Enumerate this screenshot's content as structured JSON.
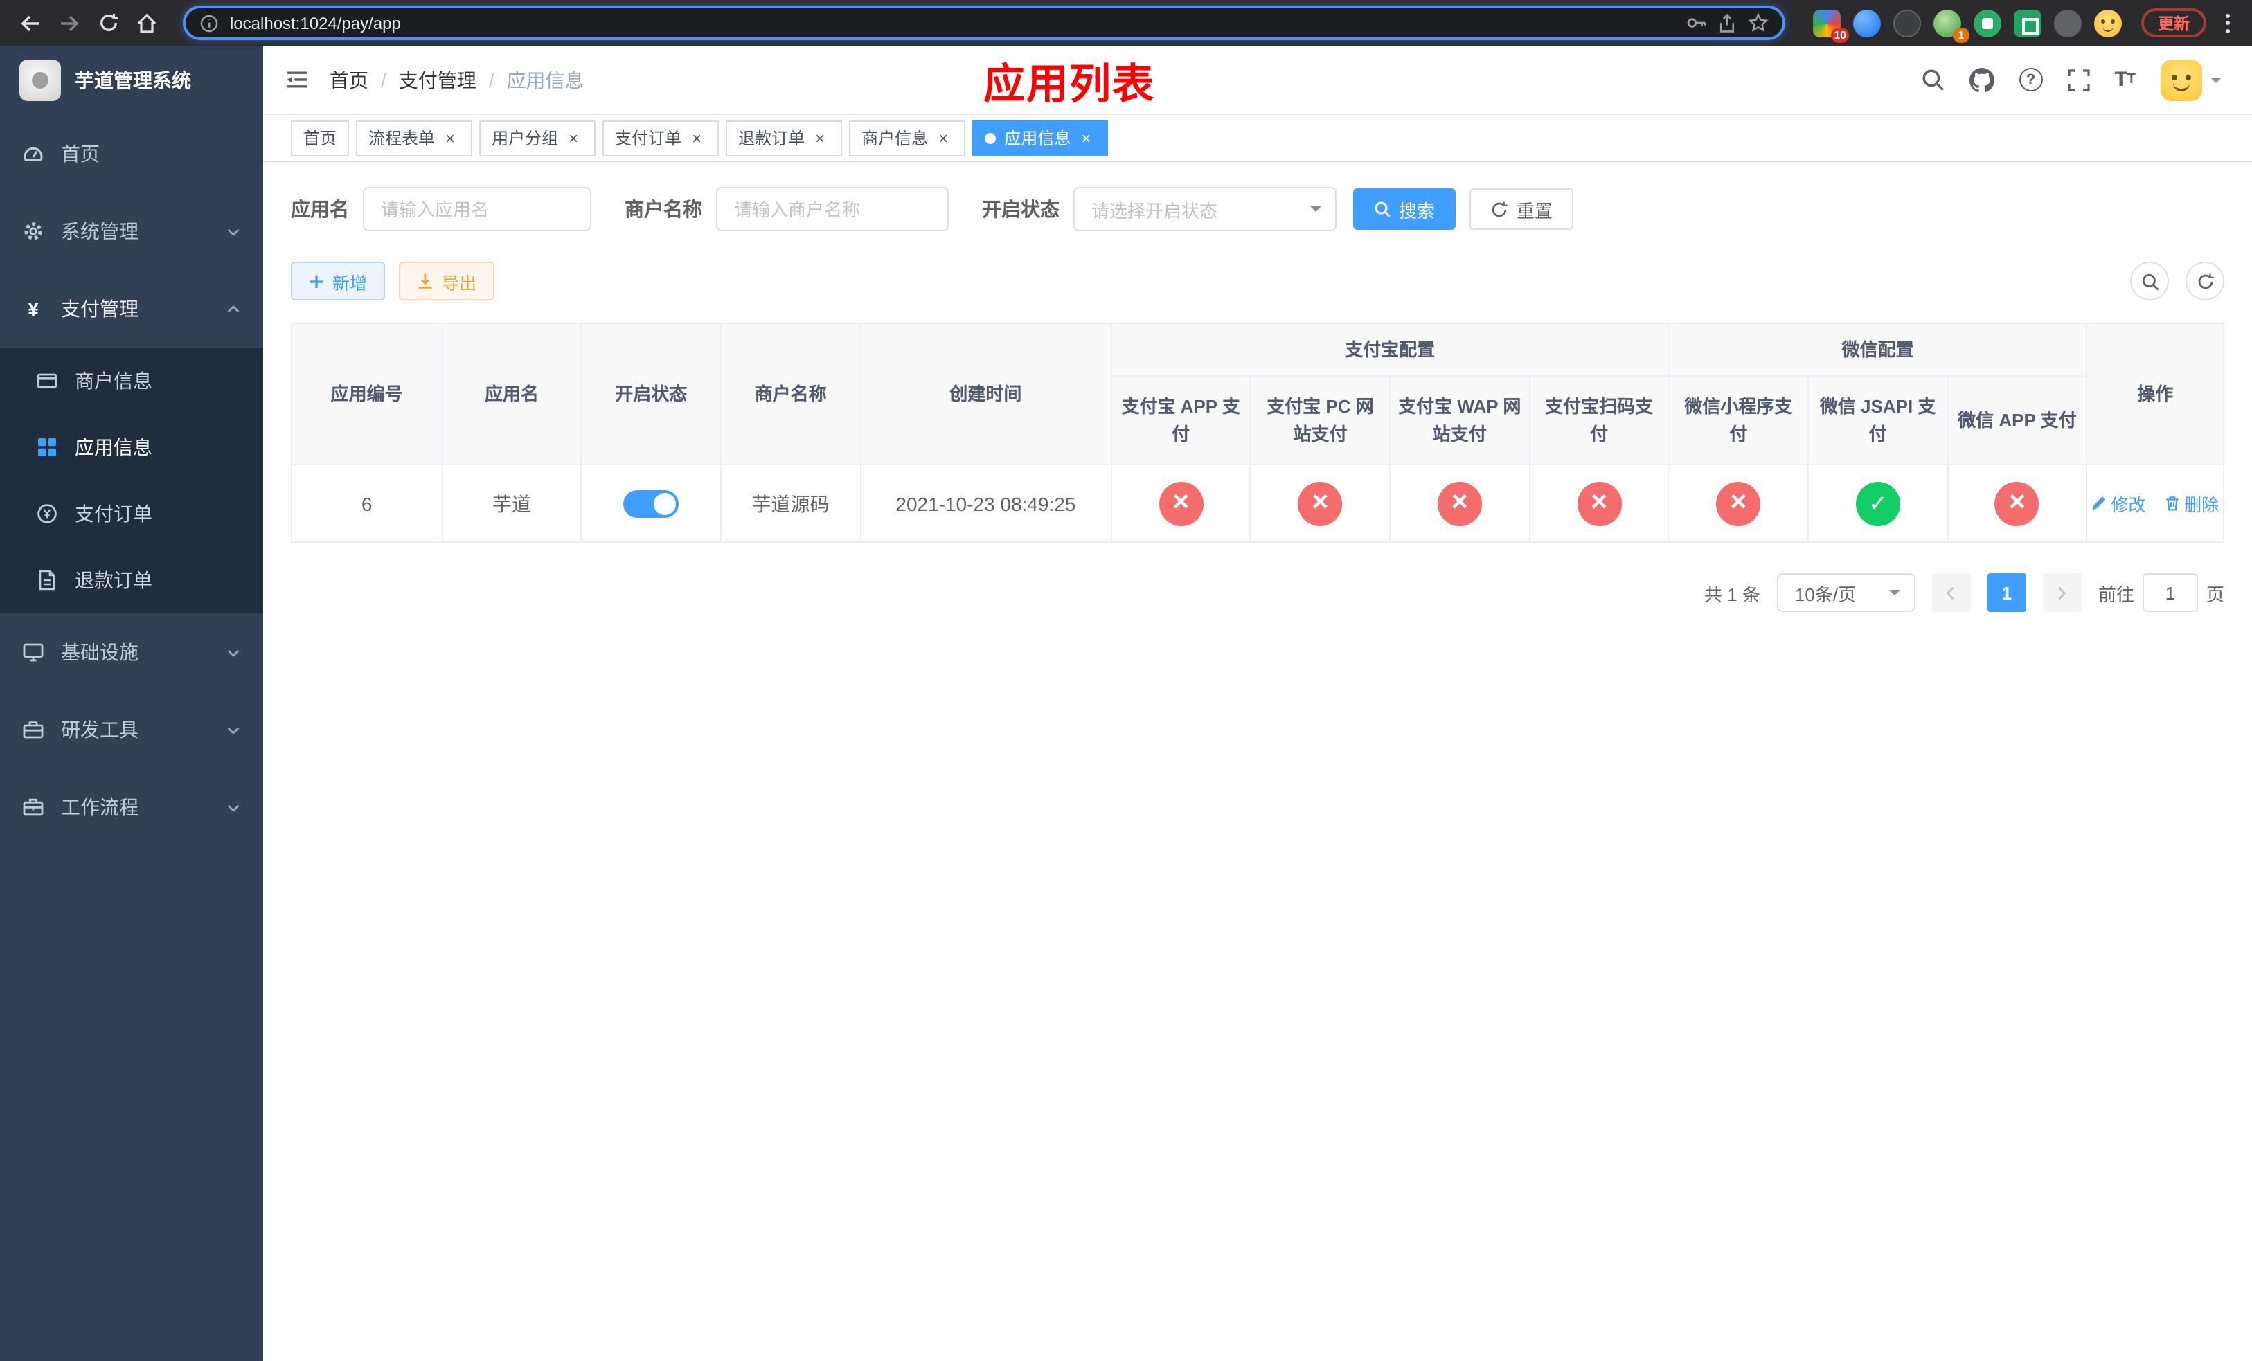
{
  "colors": {
    "accent_blue": "#409eff",
    "success_green": "#13ce66",
    "danger_red": "#f56c6c",
    "warning_orange": "#e6a23c",
    "title_red": "#ff0000",
    "sidebar_bg": "#304156",
    "sidebar_submenu_bg": "#1f2d3d"
  },
  "browser": {
    "url": "localhost:1024/pay/app",
    "update_button": "更新",
    "extensions": [
      {
        "name": "ext-multicolor",
        "badge": "10"
      },
      {
        "name": "ext-blue",
        "badge": ""
      },
      {
        "name": "ext-dark",
        "badge": ""
      },
      {
        "name": "ext-green-avatar",
        "badge": "1"
      },
      {
        "name": "ext-green-circle",
        "badge": ""
      },
      {
        "name": "ext-green-square",
        "badge": ""
      },
      {
        "name": "ext-gray-pin",
        "badge": ""
      },
      {
        "name": "ext-yellow-face",
        "badge": ""
      }
    ]
  },
  "icons": {
    "browser": [
      "back",
      "forward",
      "reload",
      "home",
      "info",
      "key",
      "share",
      "star",
      "menu-dots"
    ],
    "navbar": [
      "hamburger",
      "search",
      "github",
      "help",
      "fullscreen",
      "font-size",
      "avatar",
      "caret-down"
    ]
  },
  "sidebar": {
    "app_title": "芋道管理系统",
    "items": {
      "home": "首页",
      "system": "系统管理",
      "payment": "支付管理",
      "merchant_info": "商户信息",
      "app_info": "应用信息",
      "pay_order": "支付订单",
      "refund_order": "退款订单",
      "infra": "基础设施",
      "dev_tools": "研发工具",
      "workflow": "工作流程"
    }
  },
  "navbar": {
    "breadcrumb": {
      "home": "首页",
      "payment": "支付管理",
      "current": "应用信息"
    },
    "page_title": "应用列表"
  },
  "tabs": [
    {
      "label": "首页"
    },
    {
      "label": "流程表单"
    },
    {
      "label": "用户分组"
    },
    {
      "label": "支付订单"
    },
    {
      "label": "退款订单"
    },
    {
      "label": "商户信息"
    },
    {
      "label": "应用信息"
    }
  ],
  "filters": {
    "app_name": {
      "label": "应用名",
      "placeholder": "请输入应用名",
      "value": ""
    },
    "merchant_name": {
      "label": "商户名称",
      "placeholder": "请输入商户名称",
      "value": ""
    },
    "status": {
      "label": "开启状态",
      "placeholder": "请选择开启状态",
      "value": ""
    },
    "search": "搜索",
    "reset": "重置"
  },
  "actions": {
    "add": "新增",
    "export": "导出"
  },
  "table": {
    "groups": {
      "alipay": "支付宝配置",
      "wechat": "微信配置"
    },
    "headers": {
      "id": "应用编号",
      "name": "应用名",
      "status": "开启状态",
      "merchant": "商户名称",
      "created": "创建时间",
      "alipay_app": "支付宝 APP 支付",
      "alipay_pc": "支付宝 PC 网站支付",
      "alipay_wap": "支付宝 WAP 网站支付",
      "alipay_qr": "支付宝扫码支付",
      "wx_mini": "微信小程序支付",
      "wx_jsapi": "微信 JSAPI 支付",
      "wx_app": "微信 APP 支付",
      "ops": "操作"
    },
    "rows": [
      {
        "id": "6",
        "name": "芋道",
        "enabled": true,
        "merchant": "芋道源码",
        "created": "2021-10-23 08:49:25",
        "alipay_app": false,
        "alipay_pc": false,
        "alipay_wap": false,
        "alipay_qr": false,
        "wx_mini": false,
        "wx_jsapi": true,
        "wx_app": false,
        "edit": "修改",
        "remove": "删除"
      }
    ]
  },
  "pagination": {
    "total": "共 1 条",
    "page_size": "10条/页",
    "page": "1",
    "goto_label": "前往",
    "goto_value": "1",
    "goto_unit": "页"
  }
}
